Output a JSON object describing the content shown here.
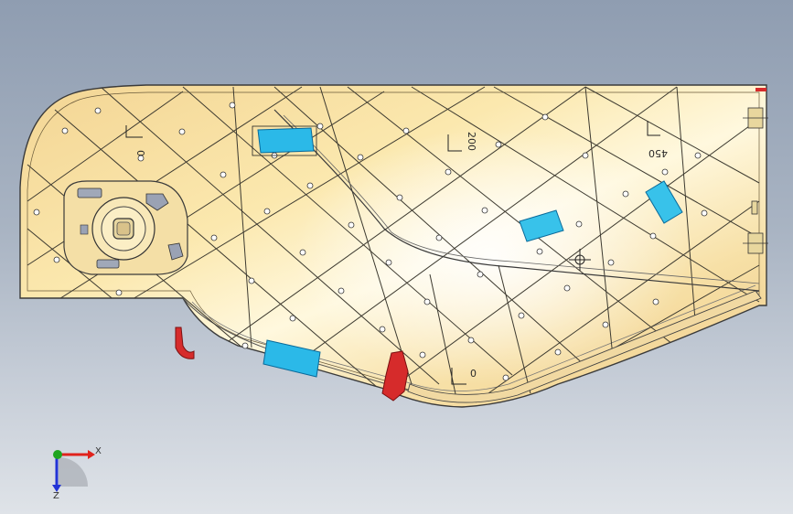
{
  "viewport": {
    "background_top": "#8f9db1",
    "background_bottom": "#dfe3e8"
  },
  "part": {
    "fill_light": "#fff3c4",
    "fill_mid": "#f6dea0",
    "fill_dark": "#ebc37a",
    "outline": "#3a3a3a",
    "clip_color": "#2bb9e8",
    "tab_color": "#d62b2b"
  },
  "annotations": {
    "label_0_left": "0",
    "label_200": "200",
    "label_450": "450",
    "label_0_bottom": "0"
  },
  "triad": {
    "x_label": "X",
    "z_label": "Z",
    "x_color": "#e0231c",
    "y_color": "#1fa51f",
    "z_color": "#2233d6"
  }
}
